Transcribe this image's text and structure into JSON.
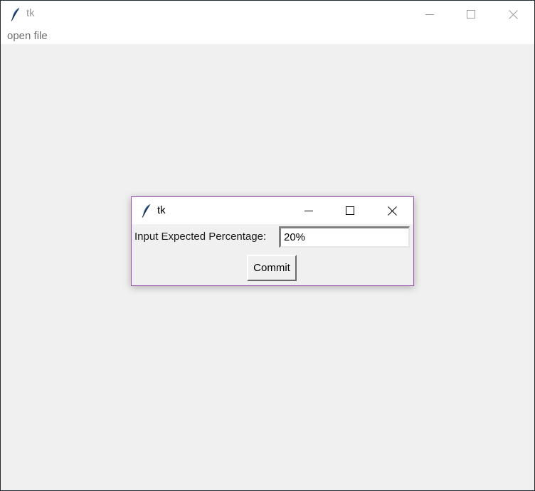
{
  "main_window": {
    "title": "tk",
    "menu": [
      "open file"
    ],
    "controls": [
      "minimize-icon",
      "maximize-icon",
      "close-icon"
    ]
  },
  "dialog": {
    "title": "tk",
    "label": "Input Expected Percentage:",
    "entry_value": "20%",
    "commit_label": "Commit",
    "controls": [
      "minimize-icon",
      "maximize-icon",
      "close-icon"
    ]
  },
  "colors": {
    "window_bg": "#f0f0f0",
    "titlebar_bg": "#ffffff",
    "dialog_border": "#9b4fb5",
    "inactive_text": "#9a9a9a"
  }
}
